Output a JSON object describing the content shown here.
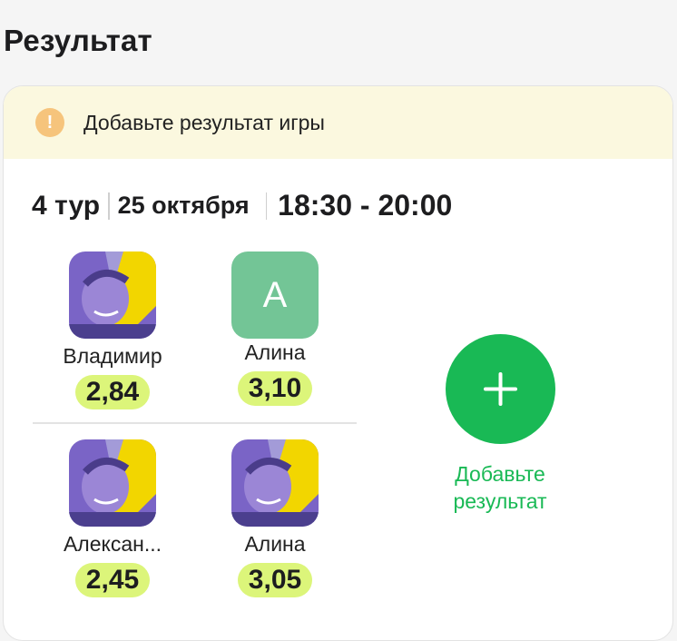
{
  "page": {
    "title": "Результат"
  },
  "banner": {
    "text": "Добавьте результат игры",
    "icon": "warning-icon",
    "icon_glyph": "!"
  },
  "match": {
    "round": "4 тур",
    "date": "25 октября",
    "time": "18:30 - 20:00"
  },
  "players": [
    {
      "name": "Владимир",
      "score": "2,84",
      "avatar": "photo"
    },
    {
      "name": "Алина",
      "score": "3,10",
      "avatar": "letter",
      "initial": "А"
    },
    {
      "name": "Алексан...",
      "score": "2,45",
      "avatar": "photo"
    },
    {
      "name": "Алина",
      "score": "3,05",
      "avatar": "photo"
    }
  ],
  "add_result": {
    "label": "Добавьте результат",
    "icon": "plus-icon"
  },
  "colors": {
    "accent_green": "#19b955",
    "score_badge": "#dcf57a",
    "banner_bg": "#fbf8df",
    "warning": "#f6c47c",
    "letter_avatar": "#73c596"
  }
}
